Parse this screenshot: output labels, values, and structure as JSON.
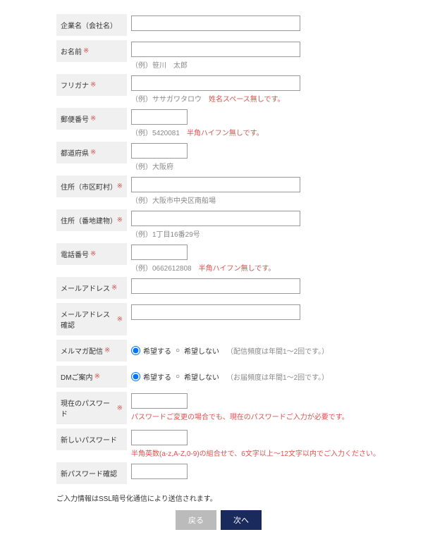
{
  "labels": {
    "company": "企業名（会社名）",
    "name": "お名前",
    "furigana": "フリガナ",
    "postal": "郵便番号",
    "prefecture": "都道府県",
    "address1": "住所（市区町村）",
    "address2": "住所（番地建物）",
    "phone": "電話番号",
    "email": "メールアドレス",
    "email_confirm": "メールアドレス確認",
    "mailmag": "メルマガ配信",
    "dm": "DMご案内",
    "current_pw": "現在のパスワード",
    "new_pw": "新しいパスワード",
    "new_pw_confirm": "新パスワード確認"
  },
  "required_mark": "※",
  "hints": {
    "name": "（例）笹川　太郎",
    "furigana": "（例）ササガワタロウ",
    "furigana_red": "姓名スペース無しです。",
    "postal": "（例）5420081",
    "postal_red": "半角ハイフン無しです。",
    "prefecture": "（例）大阪府",
    "address1": "（例）大阪市中央区南船場",
    "address2": "（例）1丁目16番29号",
    "phone": "（例）0662612808",
    "phone_red": "半角ハイフン無しです。",
    "current_pw_red": "パスワードご変更の場合でも、現在のパスワードご入力が必要です。",
    "new_pw_red": "半角英数(a-z,A-Z,0-9)の組合せで、6文字以上～12文字以内でご入力ください。"
  },
  "radio": {
    "yes": "希望する",
    "no": "希望しない",
    "mailmag_note": "（配信頻度は年間1～2回です。）",
    "dm_note": "（お届頻度は年間1～2回です。）"
  },
  "ssl_note": "ご入力情報はSSL暗号化通信により送信されます。",
  "buttons": {
    "back": "戻る",
    "next": "次へ"
  }
}
